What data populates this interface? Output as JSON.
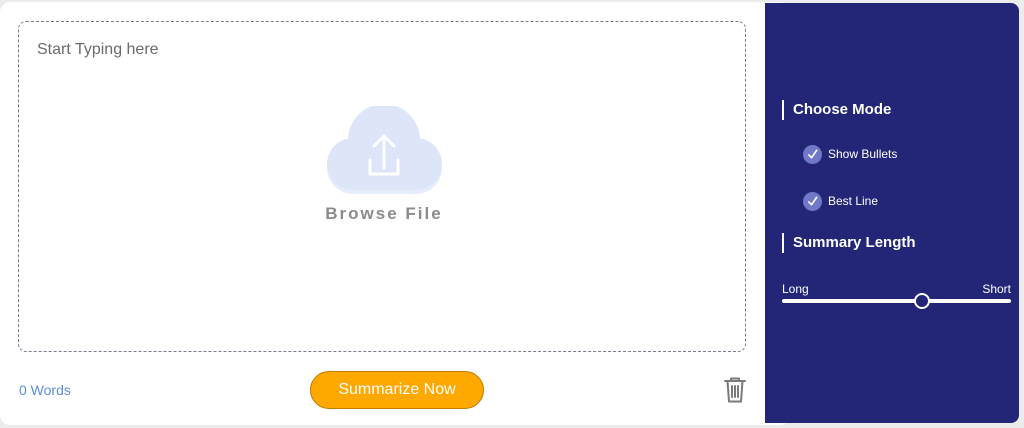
{
  "editor": {
    "placeholder": "Start Typing here",
    "upload_icon": "cloud-upload-icon",
    "browse_label": "Browse File"
  },
  "footer": {
    "word_count": "0 Words",
    "summarize_label": "Summarize Now",
    "delete_icon": "trash-icon"
  },
  "sidebar": {
    "mode_title": "Choose Mode",
    "options": [
      {
        "label": "Show Bullets",
        "checked": true
      },
      {
        "label": "Best Line",
        "checked": true
      }
    ],
    "length_title": "Summary Length",
    "slider": {
      "min_label": "Long",
      "max_label": "Short",
      "value_fraction": 0.61
    }
  },
  "colors": {
    "sidebar_bg": "#232677",
    "button_bg": "#ffa800",
    "word_count": "#5b8fd6",
    "cloud": "#dfe8f8",
    "check_bg": "#6f79c8"
  }
}
